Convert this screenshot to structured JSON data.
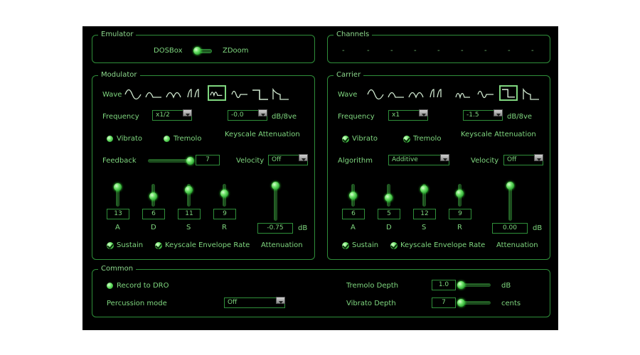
{
  "emulator": {
    "title": "Emulator",
    "left_label": "DOSBox",
    "right_label": "ZDoom"
  },
  "channels": {
    "title": "Channels",
    "items": [
      "-",
      "-",
      "-",
      "-",
      "-",
      "-",
      "-",
      "-",
      "-"
    ]
  },
  "modulator": {
    "title": "Modulator",
    "wave_label": "Wave",
    "frequency_label": "Frequency",
    "frequency_value": "x1/2",
    "level_value": "-0.0",
    "level_unit": "dB/8ve",
    "keyscale_label": "Keyscale Attenuation",
    "vibrato_label": "Vibrato",
    "tremolo_label": "Tremolo",
    "feedback_label": "Feedback",
    "feedback_value": "7",
    "velocity_label": "Velocity",
    "velocity_value": "Off",
    "adsr_values": [
      "13",
      "6",
      "11",
      "9"
    ],
    "adsr_labels": [
      "A",
      "D",
      "S",
      "R"
    ],
    "attenuation_value": "-0.75",
    "attenuation_unit": "dB",
    "attenuation_label": "Attenuation",
    "sustain_label": "Sustain",
    "keyscale_env_label": "Keyscale Envelope Rate"
  },
  "carrier": {
    "title": "Carrier",
    "wave_label": "Wave",
    "frequency_label": "Frequency",
    "frequency_value": "x1",
    "level_value": "-1.5",
    "level_unit": "dB/8ve",
    "keyscale_label": "Keyscale Attenuation",
    "vibrato_label": "Vibrato",
    "tremolo_label": "Tremolo",
    "algorithm_label": "Algorithm",
    "algorithm_value": "Additive",
    "velocity_label": "Velocity",
    "velocity_value": "Off",
    "adsr_values": [
      "6",
      "5",
      "12",
      "9"
    ],
    "adsr_labels": [
      "A",
      "D",
      "S",
      "R"
    ],
    "attenuation_value": "0.00",
    "attenuation_unit": "dB",
    "attenuation_label": "Attenuation",
    "sustain_label": "Sustain",
    "keyscale_env_label": "Keyscale Envelope Rate"
  },
  "common": {
    "title": "Common",
    "record_label": "Record to DRO",
    "percussion_label": "Percussion mode",
    "percussion_value": "Off",
    "tremolo_depth_label": "Tremolo Depth",
    "tremolo_depth_value": "1.0",
    "tremolo_depth_unit": "dB",
    "vibrato_depth_label": "Vibrato Depth",
    "vibrato_depth_value": "7",
    "vibrato_depth_unit": "cents"
  }
}
